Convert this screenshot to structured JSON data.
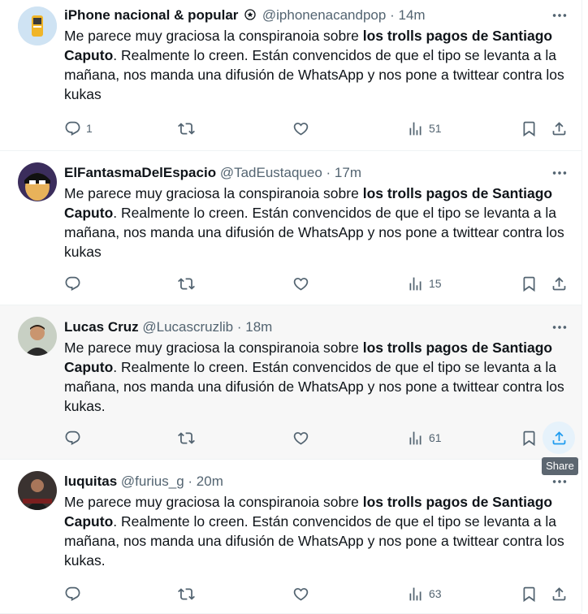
{
  "tweets": [
    {
      "name": "iPhone nacional & popular",
      "handle": "@iphonenacandpop",
      "time": "14m",
      "text_pre": "Me parece muy graciosa la conspiranoia sobre ",
      "text_bold_1": "los trolls pagos de Santiago",
      "text_bold_2": "Caputo",
      "text_post": ". Realmente lo creen. Están convencidos de que el tipo se levanta a la mañana, nos manda una difusión de WhatsApp y nos pone a twittear contra los kukas",
      "replies": "1",
      "views": "51"
    },
    {
      "name": "ElFantasmaDelEspacio",
      "handle": "@TadEustaqueo",
      "time": "17m",
      "text_pre": "Me parece muy graciosa la conspiranoia sobre ",
      "text_bold_1": "los trolls pagos de Santiago",
      "text_bold_2": "Caputo",
      "text_post": ". Realmente lo creen. Están convencidos de que el tipo se levanta a la mañana, nos manda una difusión de WhatsApp y nos pone a twittear contra los kukas",
      "replies": "",
      "views": "15"
    },
    {
      "name": "Lucas Cruz",
      "handle": "@Lucascruzlib",
      "time": "18m",
      "text_pre": "Me parece muy graciosa la conspiranoia sobre ",
      "text_bold_1": "los trolls pagos de Santiago",
      "text_bold_2": "Caputo",
      "text_post": ". Realmente lo creen. Están convencidos de que el tipo se levanta a la mañana, nos manda una difusión de WhatsApp y nos pone a twittear contra los kukas.",
      "replies": "",
      "views": "61"
    },
    {
      "name": "luquitas",
      "handle": "@furius_g",
      "time": "20m",
      "text_pre": "Me parece muy graciosa la conspiranoia sobre ",
      "text_bold_1": "los trolls pagos de Santiago",
      "text_bold_2": "Caputo",
      "text_post": ". Realmente lo creen. Están convencidos de que el tipo se levanta a la mañana, nos manda una difusión de WhatsApp y nos pone a twittear contra los kukas.",
      "replies": "",
      "views": "63"
    }
  ],
  "tooltip": "Share",
  "separator": "·",
  "colors": {
    "text": "#0f1419",
    "muted": "#536471",
    "accent": "#1d9bf0",
    "hover_bg": "#f7f7f7"
  },
  "icons": [
    "reply-icon",
    "retweet-icon",
    "like-icon",
    "views-icon",
    "bookmark-icon",
    "share-icon",
    "more-icon",
    "verified-icon"
  ]
}
